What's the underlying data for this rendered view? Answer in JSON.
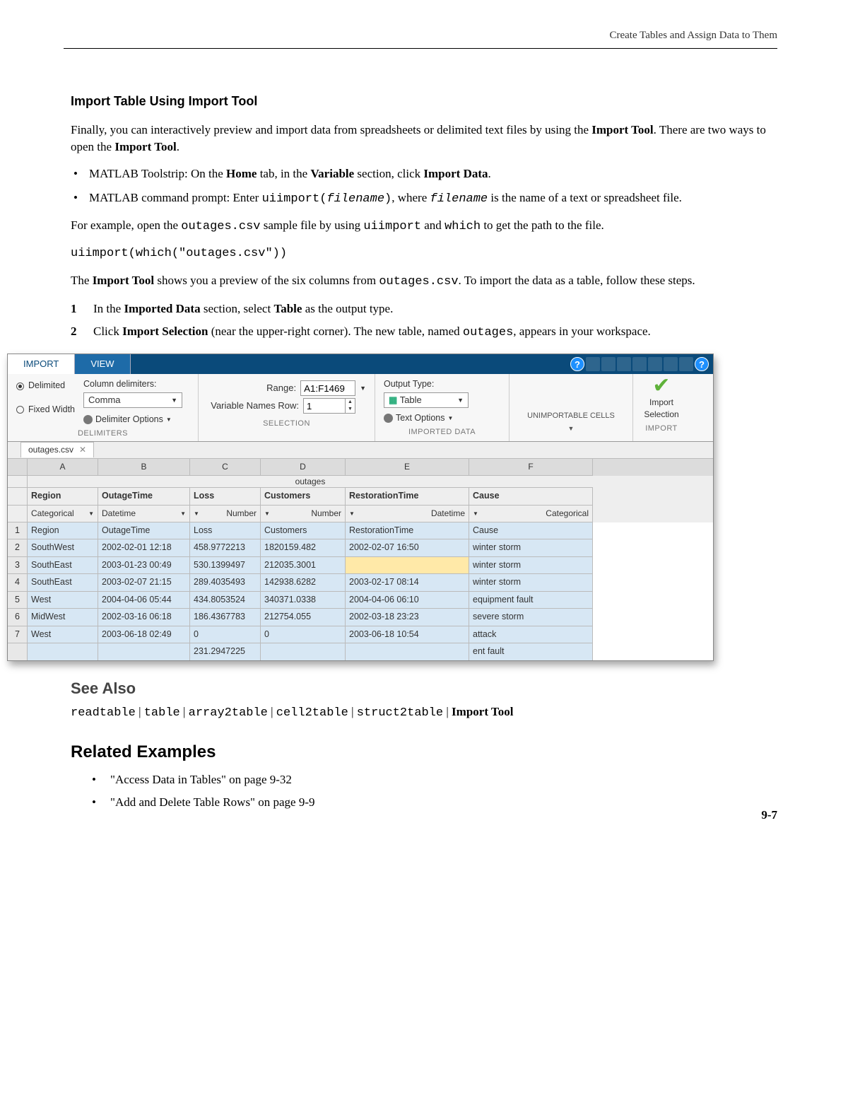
{
  "header": {
    "running_head": "Create Tables and Assign Data to Them"
  },
  "section1": {
    "title": "Import Table Using Import Tool",
    "p1_a": "Finally, you can interactively preview and import data from spreadsheets or delimited text files by using the ",
    "p1_b": "Import Tool",
    "p1_c": ". There are two ways to open the ",
    "p1_d": "Import Tool",
    "p1_e": ".",
    "b1_a": "MATLAB Toolstrip: On the ",
    "b1_b": "Home",
    "b1_c": " tab, in the ",
    "b1_d": "Variable",
    "b1_e": " section, click ",
    "b1_f": "Import Data",
    "b1_g": ".",
    "b2_a": "MATLAB command prompt: Enter ",
    "b2_b": "uiimport(",
    "b2_c": "filename",
    "b2_d": ")",
    "b2_e": ", where ",
    "b2_f": "filename",
    "b2_g": " is the name of a text or spreadsheet file.",
    "p2_a": "For example, open the ",
    "p2_b": "outages.csv",
    "p2_c": " sample file by using ",
    "p2_d": "uiimport",
    "p2_e": " and ",
    "p2_f": "which",
    "p2_g": " to get the path to the file.",
    "code": "uiimport(which(\"outages.csv\"))",
    "p3_a": "The ",
    "p3_b": "Import Tool",
    "p3_c": " shows you a preview of the six columns from ",
    "p3_d": "outages.csv",
    "p3_e": ". To import the data as a table, follow these steps.",
    "s1_a": "In the ",
    "s1_b": "Imported Data",
    "s1_c": " section, select ",
    "s1_d": "Table",
    "s1_e": " as the output type.",
    "s2_a": "Click ",
    "s2_b": "Import Selection",
    "s2_c": " (near the upper-right corner). The new table, named ",
    "s2_d": "outages",
    "s2_e": ", appears in your workspace."
  },
  "tool": {
    "tabs": {
      "import": "IMPORT",
      "view": "VIEW"
    },
    "delimited": "Delimited",
    "fixed": "Fixed Width",
    "col_delim_label": "Column delimiters:",
    "col_delim_value": "Comma",
    "delim_opts": "Delimiter Options",
    "sect_delim": "DELIMITERS",
    "range_label": "Range:",
    "range_value": "A1:F1469",
    "varrow_label": "Variable Names Row:",
    "varrow_value": "1",
    "sect_sel": "SELECTION",
    "out_type_label": "Output Type:",
    "out_type_value": "Table",
    "text_opts": "Text Options",
    "sect_imp": "IMPORTED DATA",
    "unimp": "UNIMPORTABLE CELLS",
    "imp_sel": "Import Selection",
    "sect_import": "IMPORT",
    "doc_tab": "outages.csv",
    "col_letters": [
      "",
      "A",
      "B",
      "C",
      "D",
      "E",
      "F"
    ],
    "table_name": "outages",
    "var_headers": [
      "Region",
      "OutageTime",
      "Loss",
      "Customers",
      "RestorationTime",
      "Cause"
    ],
    "var_types": [
      "Categorical",
      "Datetime",
      "Number",
      "Number",
      "Datetime",
      "Categorical"
    ],
    "rows": [
      [
        "1",
        "Region",
        "OutageTime",
        "Loss",
        "Customers",
        "RestorationTime",
        "Cause"
      ],
      [
        "2",
        "SouthWest",
        "2002-02-01 12:18",
        "458.9772213",
        "1820159.482",
        "2002-02-07 16:50",
        "winter storm"
      ],
      [
        "3",
        "SouthEast",
        "2003-01-23 00:49",
        "530.1399497",
        "212035.3001",
        "",
        "winter storm"
      ],
      [
        "4",
        "SouthEast",
        "2003-02-07 21:15",
        "289.4035493",
        "142938.6282",
        "2003-02-17 08:14",
        "winter storm"
      ],
      [
        "5",
        "West",
        "2004-04-06 05:44",
        "434.8053524",
        "340371.0338",
        "2004-04-06 06:10",
        "equipment fault"
      ],
      [
        "6",
        "MidWest",
        "2002-03-16 06:18",
        "186.4367783",
        "212754.055",
        "2002-03-18 23:23",
        "severe storm"
      ],
      [
        "7",
        "West",
        "2003-06-18 02:49",
        "0",
        "0",
        "2003-06-18 10:54",
        "attack"
      ]
    ],
    "partial": [
      "",
      "",
      "",
      "231.2947225",
      "",
      "",
      "ent fault"
    ]
  },
  "see_also": {
    "title": "See Also",
    "items": [
      "readtable",
      "table",
      "array2table",
      "cell2table",
      "struct2table"
    ],
    "last": "Import Tool"
  },
  "related": {
    "title": "Related Examples",
    "i1": "\"Access Data in Tables\" on page 9-32",
    "i2": "\"Add and Delete Table Rows\" on page 9-9"
  },
  "page_num": "9-7"
}
